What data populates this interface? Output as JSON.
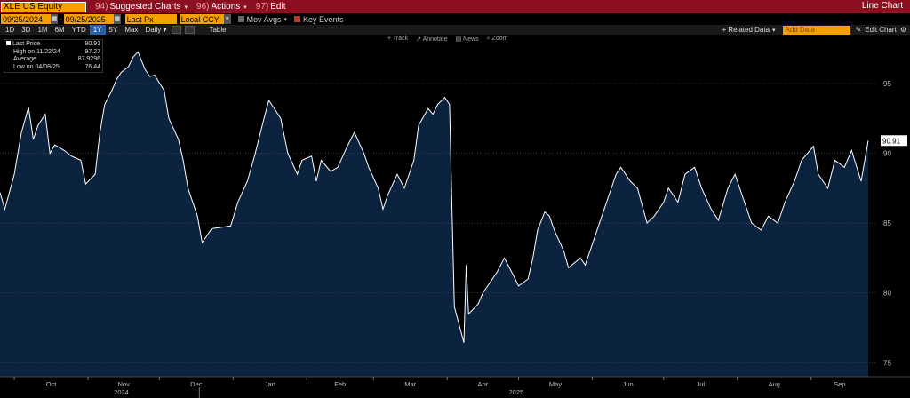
{
  "toolbar": {
    "ticker": "XLE US Equity",
    "suggested_num": "94)",
    "suggested_label": "Suggested Charts",
    "actions_num": "96)",
    "actions_label": "Actions",
    "edit_num": "97)",
    "edit_label": "Edit",
    "window_title": "Line Chart"
  },
  "controls": {
    "start_date": "09/25/2024",
    "end_date": "09/25/2025",
    "field": "Last Px",
    "currency": "Local CCY",
    "mov_avgs": "Mov Avgs",
    "key_events": "Key Events"
  },
  "ranges": [
    "1D",
    "3D",
    "1M",
    "6M",
    "YTD",
    "1Y",
    "5Y",
    "Max"
  ],
  "active_range": "1Y",
  "periodicity": "Daily",
  "table_label": "Table",
  "right_tools": {
    "related": "+ Related Data",
    "add_data_placeholder": "Add Data",
    "edit_chart": "Edit Chart"
  },
  "chart_tools": [
    "+ Track",
    "↗ Annotate",
    "▤ News",
    "⌕ Zoom"
  ],
  "legend": {
    "last_label": "Last Price",
    "last_value": "90.91",
    "high_label": "High on 11/22/24",
    "high_value": "97.27",
    "avg_label": "Average",
    "avg_value": "87.9296",
    "low_label": "Low on 04/08/25",
    "low_value": "76.44"
  },
  "colors": {
    "line": "#ffffff",
    "fill": "#0c2340",
    "grid": "#555555",
    "accent": "#f5a000",
    "header": "#8b0f20"
  },
  "chart_data": {
    "type": "area",
    "series_name": "Last Price",
    "ylim": [
      74,
      98.5
    ],
    "y_ticks": [
      75,
      80,
      85,
      90,
      95
    ],
    "last_value_label": "90.91",
    "x_month_labels": [
      "Oct",
      "Nov",
      "Dec",
      "Jan",
      "Feb",
      "Mar",
      "Apr",
      "May",
      "Jun",
      "Jul",
      "Aug",
      "Sep"
    ],
    "x_year_labels": [
      {
        "after": "Nov",
        "year": "2024"
      },
      {
        "after": "Apr",
        "year": "2025"
      }
    ],
    "points": [
      [
        "2024-09-25",
        87.2
      ],
      [
        "2024-09-27",
        86.0
      ],
      [
        "2024-10-01",
        88.5
      ],
      [
        "2024-10-04",
        91.5
      ],
      [
        "2024-10-07",
        93.3
      ],
      [
        "2024-10-09",
        91.0
      ],
      [
        "2024-10-11",
        92.0
      ],
      [
        "2024-10-14",
        92.8
      ],
      [
        "2024-10-16",
        90.0
      ],
      [
        "2024-10-18",
        90.6
      ],
      [
        "2024-10-22",
        90.2
      ],
      [
        "2024-10-25",
        89.8
      ],
      [
        "2024-10-29",
        89.5
      ],
      [
        "2024-10-31",
        87.8
      ],
      [
        "2024-11-04",
        88.5
      ],
      [
        "2024-11-06",
        91.5
      ],
      [
        "2024-11-08",
        93.5
      ],
      [
        "2024-11-11",
        94.5
      ],
      [
        "2024-11-13",
        95.3
      ],
      [
        "2024-11-15",
        95.8
      ],
      [
        "2024-11-18",
        96.2
      ],
      [
        "2024-11-20",
        96.9
      ],
      [
        "2024-11-22",
        97.27
      ],
      [
        "2024-11-25",
        96.0
      ],
      [
        "2024-11-27",
        95.5
      ],
      [
        "2024-11-29",
        95.6
      ],
      [
        "2024-12-03",
        94.5
      ],
      [
        "2024-12-05",
        92.5
      ],
      [
        "2024-12-09",
        91.0
      ],
      [
        "2024-12-11",
        89.5
      ],
      [
        "2024-12-13",
        87.5
      ],
      [
        "2024-12-17",
        85.5
      ],
      [
        "2024-12-19",
        83.6
      ],
      [
        "2024-12-23",
        84.6
      ],
      [
        "2024-12-27",
        84.7
      ],
      [
        "2024-12-31",
        84.8
      ],
      [
        "2025-01-03",
        86.5
      ],
      [
        "2025-01-07",
        88.0
      ],
      [
        "2025-01-10",
        89.8
      ],
      [
        "2025-01-14",
        92.5
      ],
      [
        "2025-01-16",
        93.8
      ],
      [
        "2025-01-21",
        92.5
      ],
      [
        "2025-01-24",
        90.0
      ],
      [
        "2025-01-28",
        88.5
      ],
      [
        "2025-01-30",
        89.5
      ],
      [
        "2025-02-03",
        89.8
      ],
      [
        "2025-02-05",
        88.0
      ],
      [
        "2025-02-07",
        89.5
      ],
      [
        "2025-02-11",
        88.7
      ],
      [
        "2025-02-14",
        89.0
      ],
      [
        "2025-02-18",
        90.5
      ],
      [
        "2025-02-21",
        91.5
      ],
      [
        "2025-02-25",
        90.0
      ],
      [
        "2025-02-27",
        89.0
      ],
      [
        "2025-03-03",
        87.5
      ],
      [
        "2025-03-05",
        86.0
      ],
      [
        "2025-03-07",
        87.0
      ],
      [
        "2025-03-11",
        88.5
      ],
      [
        "2025-03-14",
        87.5
      ],
      [
        "2025-03-18",
        89.5
      ],
      [
        "2025-03-20",
        92.0
      ],
      [
        "2025-03-24",
        93.2
      ],
      [
        "2025-03-26",
        92.8
      ],
      [
        "2025-03-28",
        93.5
      ],
      [
        "2025-03-31",
        94.0
      ],
      [
        "2025-04-02",
        93.5
      ],
      [
        "2025-04-03",
        86.0
      ],
      [
        "2025-04-04",
        79.0
      ],
      [
        "2025-04-08",
        76.44
      ],
      [
        "2025-04-09",
        82.0
      ],
      [
        "2025-04-10",
        78.5
      ],
      [
        "2025-04-14",
        79.2
      ],
      [
        "2025-04-16",
        80.0
      ],
      [
        "2025-04-22",
        81.5
      ],
      [
        "2025-04-25",
        82.5
      ],
      [
        "2025-04-29",
        81.2
      ],
      [
        "2025-05-01",
        80.5
      ],
      [
        "2025-05-05",
        81.0
      ],
      [
        "2025-05-07",
        82.5
      ],
      [
        "2025-05-09",
        84.5
      ],
      [
        "2025-05-12",
        85.8
      ],
      [
        "2025-05-14",
        85.5
      ],
      [
        "2025-05-16",
        84.5
      ],
      [
        "2025-05-20",
        83.0
      ],
      [
        "2025-05-22",
        81.8
      ],
      [
        "2025-05-27",
        82.5
      ],
      [
        "2025-05-29",
        82.0
      ],
      [
        "2025-06-02",
        84.0
      ],
      [
        "2025-06-05",
        85.5
      ],
      [
        "2025-06-09",
        87.5
      ],
      [
        "2025-06-11",
        88.5
      ],
      [
        "2025-06-13",
        89.0
      ],
      [
        "2025-06-17",
        88.0
      ],
      [
        "2025-06-20",
        87.5
      ],
      [
        "2025-06-24",
        85.0
      ],
      [
        "2025-06-27",
        85.5
      ],
      [
        "2025-07-01",
        86.5
      ],
      [
        "2025-07-03",
        87.5
      ],
      [
        "2025-07-07",
        86.5
      ],
      [
        "2025-07-10",
        88.5
      ],
      [
        "2025-07-14",
        89.0
      ],
      [
        "2025-07-17",
        87.5
      ],
      [
        "2025-07-21",
        86.0
      ],
      [
        "2025-07-24",
        85.2
      ],
      [
        "2025-07-28",
        87.5
      ],
      [
        "2025-07-31",
        88.5
      ],
      [
        "2025-08-04",
        86.5
      ],
      [
        "2025-08-07",
        85.0
      ],
      [
        "2025-08-11",
        84.5
      ],
      [
        "2025-08-14",
        85.5
      ],
      [
        "2025-08-18",
        85.0
      ],
      [
        "2025-08-21",
        86.5
      ],
      [
        "2025-08-25",
        88.0
      ],
      [
        "2025-08-28",
        89.5
      ],
      [
        "2025-09-02",
        90.5
      ],
      [
        "2025-09-04",
        88.5
      ],
      [
        "2025-09-08",
        87.5
      ],
      [
        "2025-09-11",
        89.5
      ],
      [
        "2025-09-15",
        89.0
      ],
      [
        "2025-09-18",
        90.2
      ],
      [
        "2025-09-22",
        88.0
      ],
      [
        "2025-09-25",
        90.91
      ]
    ]
  }
}
